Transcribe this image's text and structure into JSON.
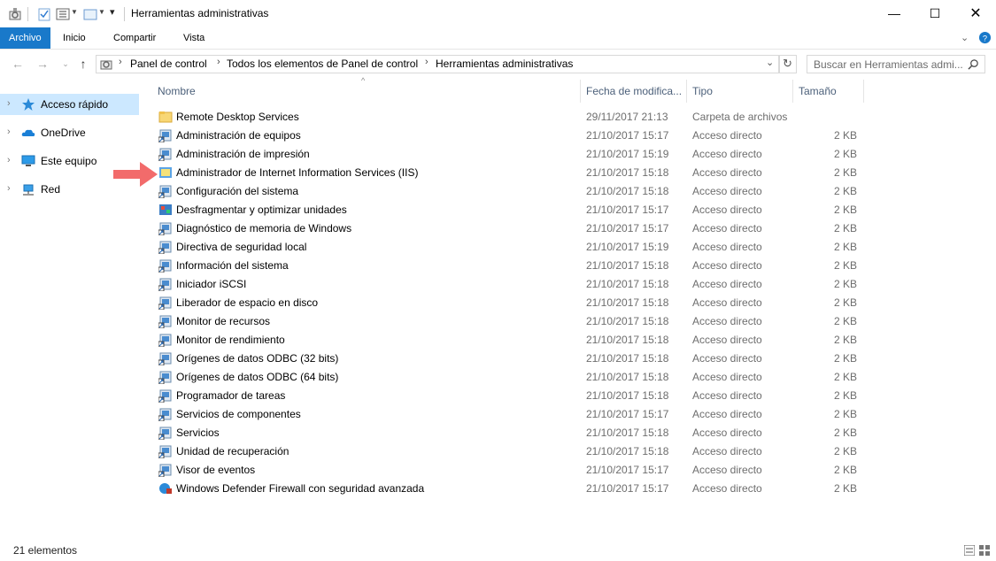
{
  "window": {
    "title": "Herramientas administrativas"
  },
  "ribbon": {
    "tabs": [
      "Archivo",
      "Inicio",
      "Compartir",
      "Vista"
    ]
  },
  "address": {
    "crumbs": [
      "Panel de control",
      "Todos los elementos de Panel de control",
      "Herramientas administrativas"
    ]
  },
  "search": {
    "placeholder": "Buscar en Herramientas admi..."
  },
  "nav": {
    "items": [
      "Acceso rápido",
      "OneDrive",
      "Este equipo",
      "Red"
    ]
  },
  "columns": {
    "name": "Nombre",
    "date": "Fecha de modifica...",
    "type": "Tipo",
    "size": "Tamaño"
  },
  "files": [
    {
      "name": "Remote Desktop Services",
      "date": "29/11/2017 21:13",
      "type": "Carpeta de archivos",
      "size": "",
      "icon": "folder-icon"
    },
    {
      "name": "Administración de equipos",
      "date": "21/10/2017 15:17",
      "type": "Acceso directo",
      "size": "2 KB",
      "icon": "computer-management-icon"
    },
    {
      "name": "Administración de impresión",
      "date": "21/10/2017 15:19",
      "type": "Acceso directo",
      "size": "2 KB",
      "icon": "print-management-icon"
    },
    {
      "name": "Administrador de Internet Information Services (IIS)",
      "date": "21/10/2017 15:18",
      "type": "Acceso directo",
      "size": "2 KB",
      "icon": "iis-manager-icon"
    },
    {
      "name": "Configuración del sistema",
      "date": "21/10/2017 15:18",
      "type": "Acceso directo",
      "size": "2 KB",
      "icon": "system-configuration-icon"
    },
    {
      "name": "Desfragmentar y optimizar unidades",
      "date": "21/10/2017 15:17",
      "type": "Acceso directo",
      "size": "2 KB",
      "icon": "defrag-icon"
    },
    {
      "name": "Diagnóstico de memoria de Windows",
      "date": "21/10/2017 15:17",
      "type": "Acceso directo",
      "size": "2 KB",
      "icon": "memory-diagnostic-icon"
    },
    {
      "name": "Directiva de seguridad local",
      "date": "21/10/2017 15:19",
      "type": "Acceso directo",
      "size": "2 KB",
      "icon": "security-policy-icon"
    },
    {
      "name": "Información del sistema",
      "date": "21/10/2017 15:18",
      "type": "Acceso directo",
      "size": "2 KB",
      "icon": "system-information-icon"
    },
    {
      "name": "Iniciador iSCSI",
      "date": "21/10/2017 15:18",
      "type": "Acceso directo",
      "size": "2 KB",
      "icon": "iscsi-icon"
    },
    {
      "name": "Liberador de espacio en disco",
      "date": "21/10/2017 15:18",
      "type": "Acceso directo",
      "size": "2 KB",
      "icon": "disk-cleanup-icon"
    },
    {
      "name": "Monitor de recursos",
      "date": "21/10/2017 15:18",
      "type": "Acceso directo",
      "size": "2 KB",
      "icon": "resource-monitor-icon"
    },
    {
      "name": "Monitor de rendimiento",
      "date": "21/10/2017 15:18",
      "type": "Acceso directo",
      "size": "2 KB",
      "icon": "performance-monitor-icon"
    },
    {
      "name": "Orígenes de datos ODBC (32 bits)",
      "date": "21/10/2017 15:18",
      "type": "Acceso directo",
      "size": "2 KB",
      "icon": "odbc-icon"
    },
    {
      "name": "Orígenes de datos ODBC (64 bits)",
      "date": "21/10/2017 15:18",
      "type": "Acceso directo",
      "size": "2 KB",
      "icon": "odbc-icon"
    },
    {
      "name": "Programador de tareas",
      "date": "21/10/2017 15:18",
      "type": "Acceso directo",
      "size": "2 KB",
      "icon": "task-scheduler-icon"
    },
    {
      "name": "Servicios de componentes",
      "date": "21/10/2017 15:17",
      "type": "Acceso directo",
      "size": "2 KB",
      "icon": "component-services-icon"
    },
    {
      "name": "Servicios",
      "date": "21/10/2017 15:18",
      "type": "Acceso directo",
      "size": "2 KB",
      "icon": "services-icon"
    },
    {
      "name": "Unidad de recuperación",
      "date": "21/10/2017 15:18",
      "type": "Acceso directo",
      "size": "2 KB",
      "icon": "recovery-drive-icon"
    },
    {
      "name": "Visor de eventos",
      "date": "21/10/2017 15:17",
      "type": "Acceso directo",
      "size": "2 KB",
      "icon": "event-viewer-icon"
    },
    {
      "name": "Windows Defender Firewall con seguridad avanzada",
      "date": "21/10/2017 15:17",
      "type": "Acceso directo",
      "size": "2 KB",
      "icon": "firewall-icon"
    }
  ],
  "status": {
    "count": "21 elementos"
  },
  "colors": {
    "accent": "#1979ca",
    "selected": "#cce8ff",
    "arrow": "#f26b6b",
    "header_text": "#4c607a"
  }
}
